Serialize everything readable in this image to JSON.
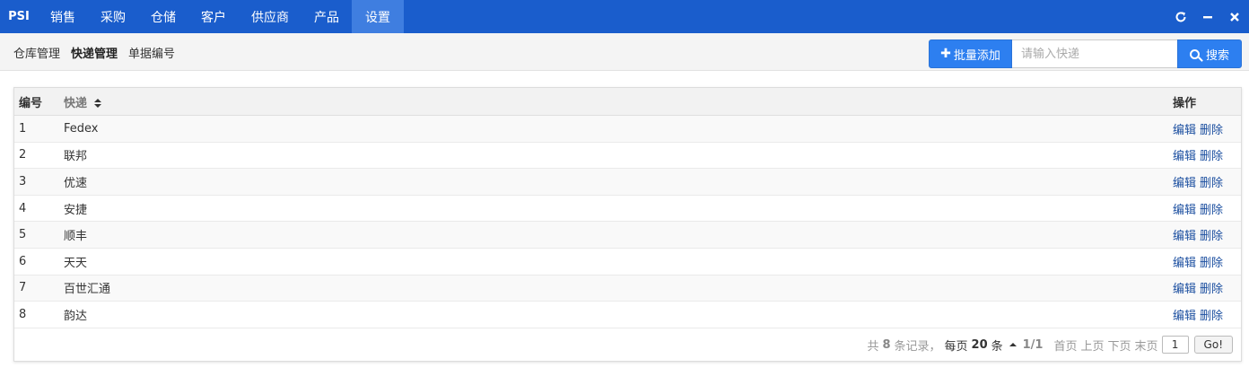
{
  "nav": {
    "brand": "PSI",
    "items": [
      {
        "label": "销售",
        "active": false
      },
      {
        "label": "采购",
        "active": false
      },
      {
        "label": "仓储",
        "active": false
      },
      {
        "label": "客户",
        "active": false
      },
      {
        "label": "供应商",
        "active": false
      },
      {
        "label": "产品",
        "active": false
      },
      {
        "label": "设置",
        "active": true
      }
    ],
    "window_controls": [
      "refresh-icon",
      "minimize-icon",
      "close-icon"
    ]
  },
  "subnav": {
    "tabs": [
      {
        "label": "仓库管理",
        "active": false
      },
      {
        "label": "快递管理",
        "active": true
      },
      {
        "label": "单据编号",
        "active": false
      }
    ]
  },
  "toolbar": {
    "add_label": "批量添加",
    "search_placeholder": "请输入快递",
    "search_label": "搜索"
  },
  "table": {
    "headers": {
      "id": "编号",
      "name": "快递",
      "ops": "操作"
    },
    "rows": [
      {
        "id": "1",
        "name": "Fedex"
      },
      {
        "id": "2",
        "name": "联邦"
      },
      {
        "id": "3",
        "name": "优速"
      },
      {
        "id": "4",
        "name": "安捷"
      },
      {
        "id": "5",
        "name": "顺丰"
      },
      {
        "id": "6",
        "name": "天天"
      },
      {
        "id": "7",
        "name": "百世汇通"
      },
      {
        "id": "8",
        "name": "韵达"
      }
    ],
    "edit_label": "编辑",
    "delete_label": "删除"
  },
  "pager": {
    "total_prefix": "共",
    "total": "8",
    "total_suffix": "条记录，",
    "per_page_prefix": "每页",
    "per_page": "20",
    "per_page_suffix": "条",
    "page_info": "1/1",
    "first": "首页",
    "prev": "上页",
    "next": "下页",
    "last": "末页",
    "current_page": "1",
    "go_label": "Go!"
  },
  "colors": {
    "nav_bg": "#1a5dcc",
    "nav_active": "#3f7ee0",
    "primary_button": "#2d7ff0",
    "link": "#1c4fa0"
  }
}
